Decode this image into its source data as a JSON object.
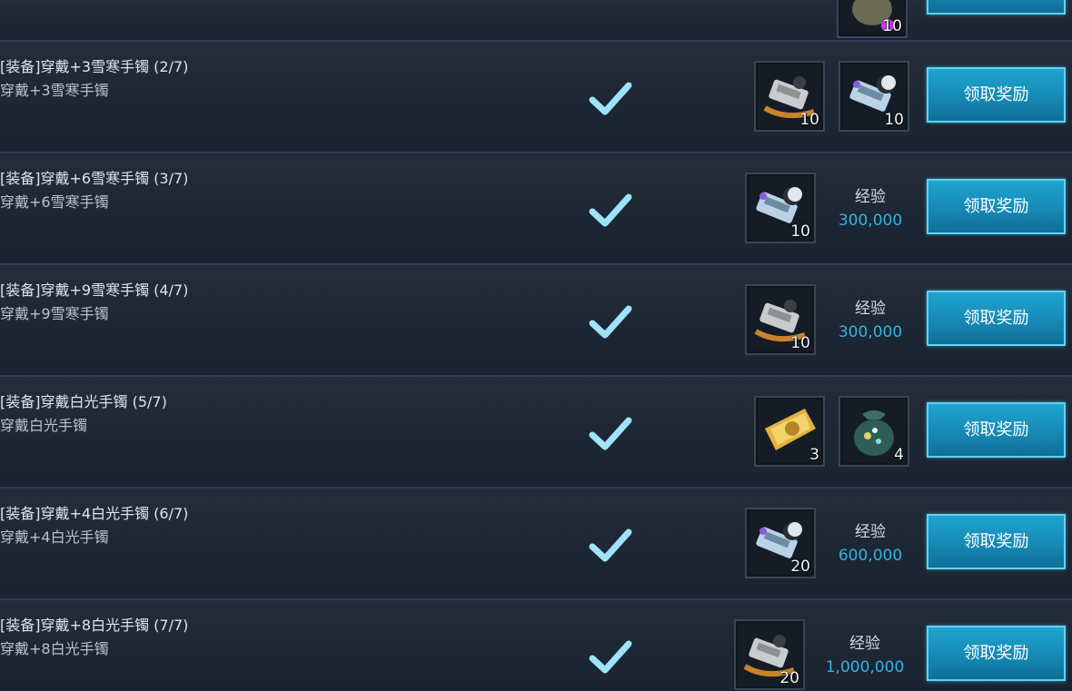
{
  "quests": [
    {
      "title": "[装备]穿戴+3雪寒手镯 (2/7)",
      "desc": "穿戴+3雪寒手镯",
      "rewards": [
        {
          "icon": "bracelet-gold-swirl-icon",
          "qty": "10"
        },
        {
          "icon": "bracelet-ice-moon-icon",
          "qty": "10"
        }
      ],
      "exp": null,
      "button": "领取奖励"
    },
    {
      "title": "[装备]穿戴+6雪寒手镯 (3/7)",
      "desc": "穿戴+6雪寒手镯",
      "rewards": [
        {
          "icon": "bracelet-ice-moon-icon",
          "qty": "10"
        }
      ],
      "exp": {
        "label": "经验",
        "value": "300,000"
      },
      "button": "领取奖励"
    },
    {
      "title": "[装备]穿戴+9雪寒手镯 (4/7)",
      "desc": "穿戴+9雪寒手镯",
      "rewards": [
        {
          "icon": "bracelet-gold-swirl-icon",
          "qty": "10"
        }
      ],
      "exp": {
        "label": "经验",
        "value": "300,000"
      },
      "button": "领取奖励"
    },
    {
      "title": "[装备]穿戴白光手镯 (5/7)",
      "desc": "穿戴白光手镯",
      "rewards": [
        {
          "icon": "gold-ticket-icon",
          "qty": "3"
        },
        {
          "icon": "gem-pouch-icon",
          "qty": "4"
        }
      ],
      "exp": null,
      "button": "领取奖励"
    },
    {
      "title": "[装备]穿戴+4白光手镯 (6/7)",
      "desc": "穿戴+4白光手镯",
      "rewards": [
        {
          "icon": "bracelet-ice-moon-icon",
          "qty": "20"
        }
      ],
      "exp": {
        "label": "经验",
        "value": "600,000"
      },
      "button": "领取奖励"
    },
    {
      "title": "[装备]穿戴+8白光手镯 (7/7)",
      "desc": "穿戴+8白光手镯",
      "rewards": [
        {
          "icon": "bracelet-gold-swirl-icon",
          "qty": "20"
        }
      ],
      "exp": {
        "label": "经验",
        "value": "1,000,000"
      },
      "button": "领取奖励"
    }
  ],
  "partial_top": {
    "qty": "10"
  },
  "colors": {
    "accent": "#33b3e0",
    "button": "#1689b6",
    "check": "#9fe3f8"
  }
}
